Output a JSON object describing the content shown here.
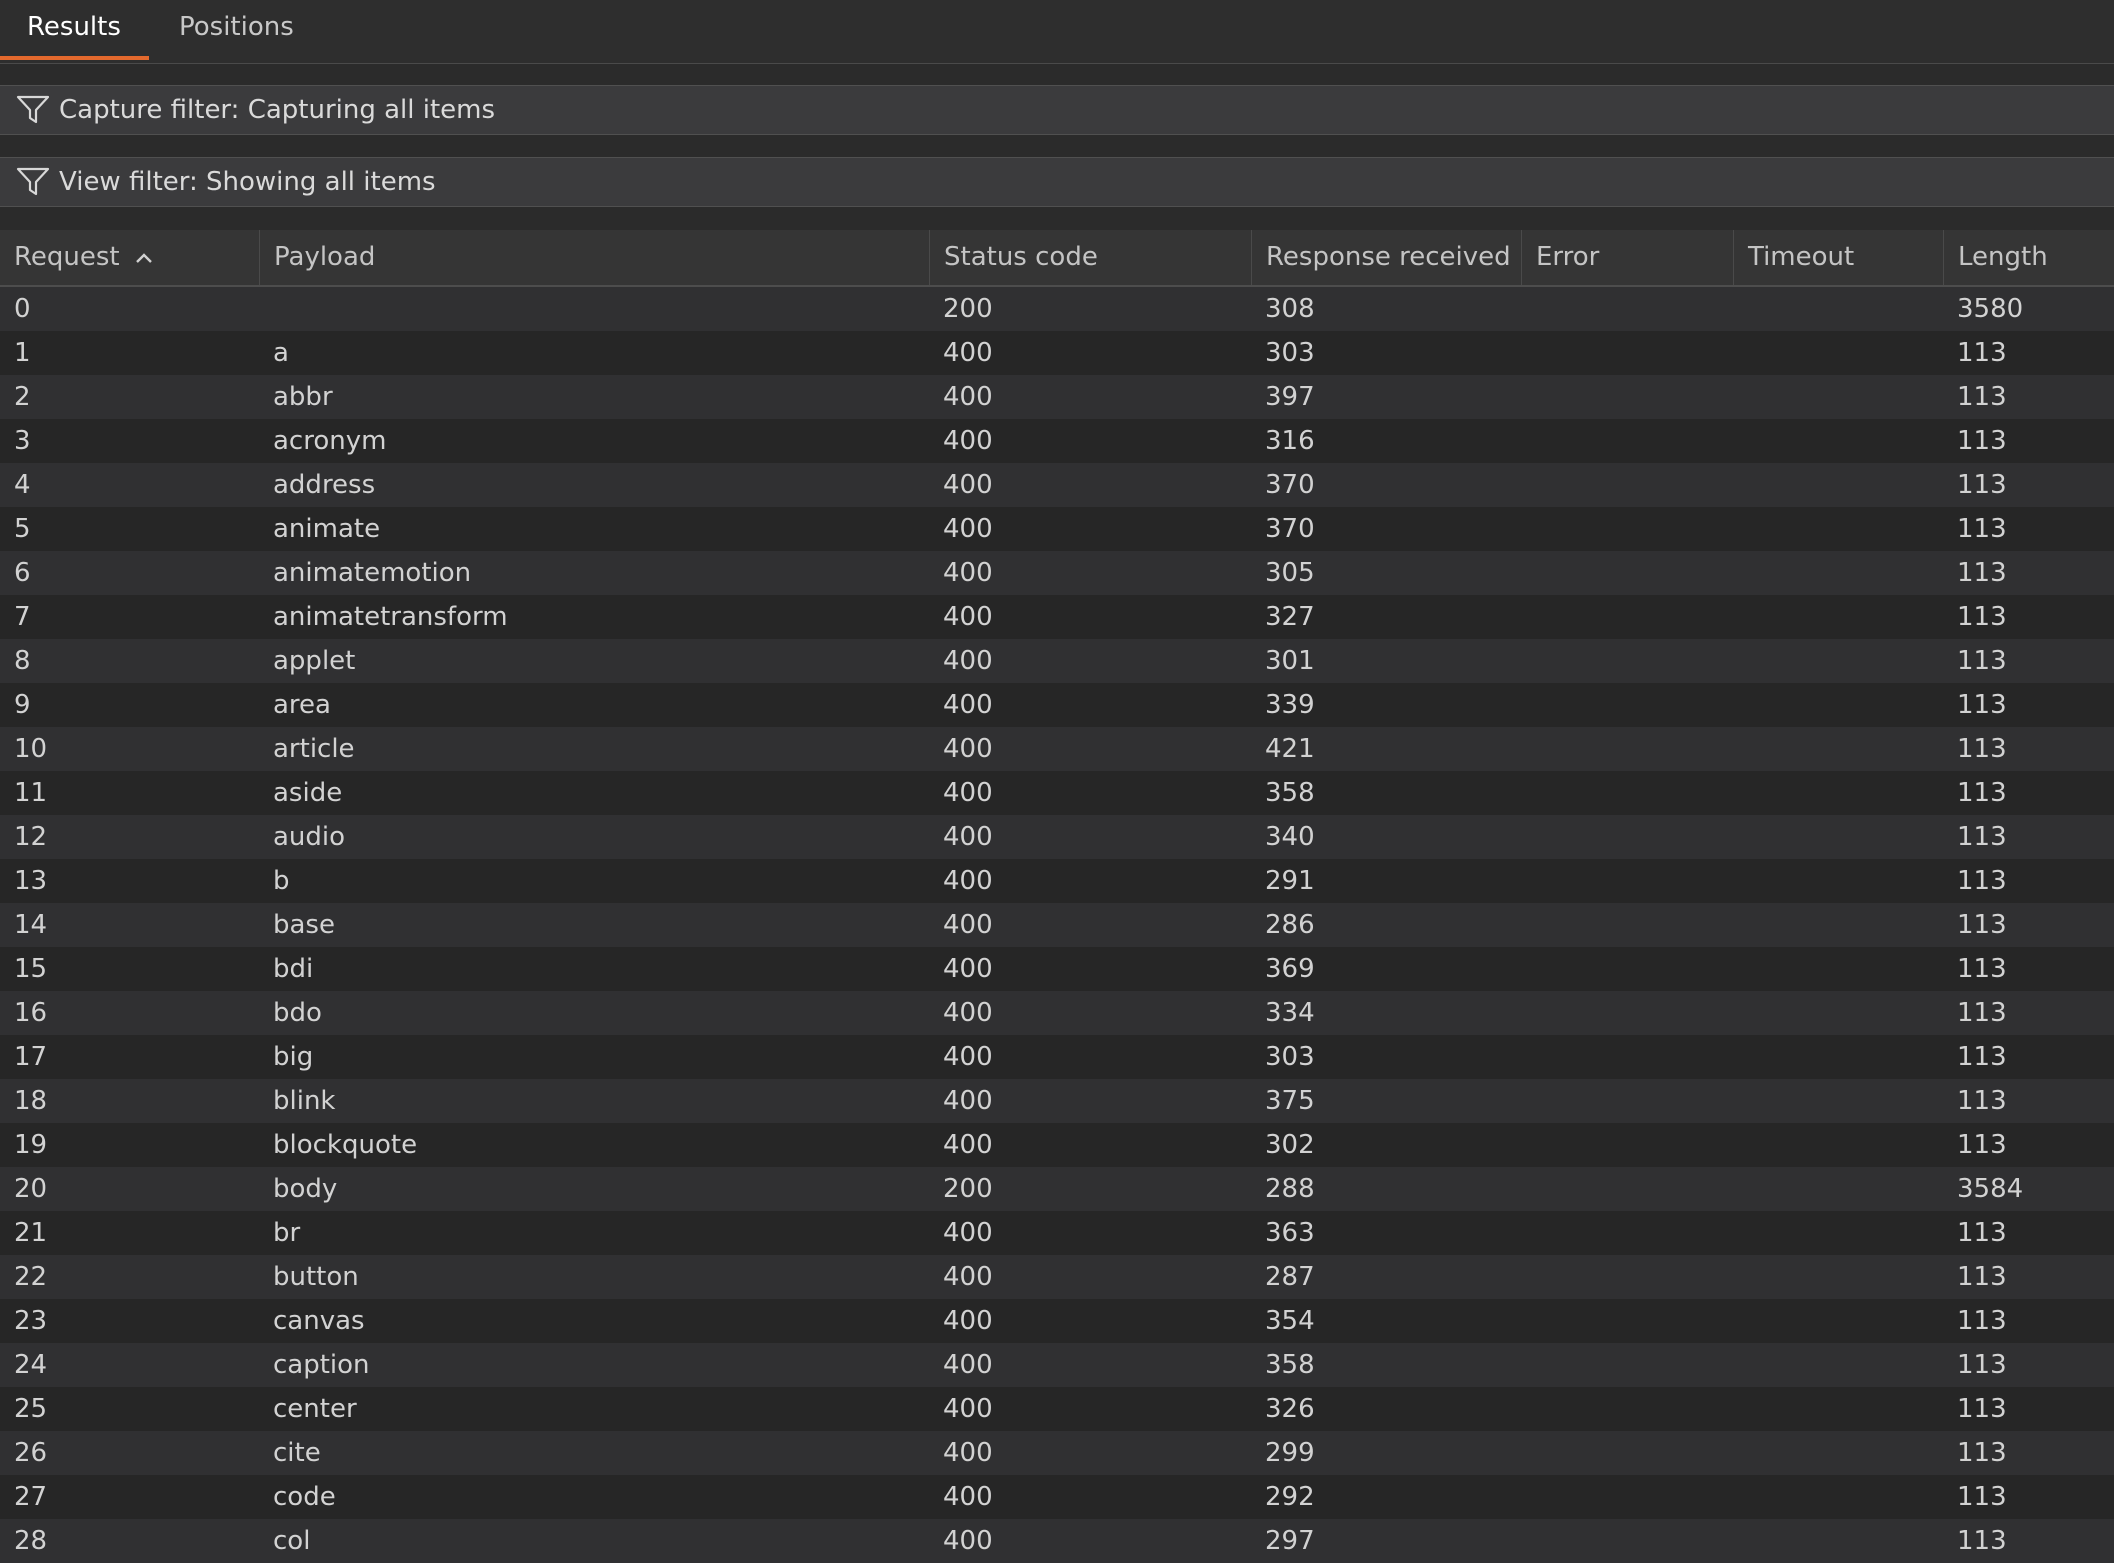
{
  "tabs": [
    {
      "label": "Results",
      "active": true
    },
    {
      "label": "Positions",
      "active": false
    }
  ],
  "filters": {
    "capture": "Capture filter: Capturing all items",
    "view": "View filter: Showing all items"
  },
  "icons": {
    "filter": "funnel-icon",
    "sort": "chevron-up-icon"
  },
  "colors": {
    "accent": "#e3692d",
    "background": "#2b2b2b"
  },
  "table": {
    "columns": [
      "Request",
      "Payload",
      "Status code",
      "Response received",
      "Error",
      "Timeout",
      "Length"
    ],
    "sort": {
      "column": "Request",
      "direction": "ascending"
    },
    "rows": [
      [
        "0",
        "",
        "200",
        "308",
        "",
        "",
        "3580"
      ],
      [
        "1",
        "a",
        "400",
        "303",
        "",
        "",
        "113"
      ],
      [
        "2",
        "abbr",
        "400",
        "397",
        "",
        "",
        "113"
      ],
      [
        "3",
        "acronym",
        "400",
        "316",
        "",
        "",
        "113"
      ],
      [
        "4",
        "address",
        "400",
        "370",
        "",
        "",
        "113"
      ],
      [
        "5",
        "animate",
        "400",
        "370",
        "",
        "",
        "113"
      ],
      [
        "6",
        "animatemotion",
        "400",
        "305",
        "",
        "",
        "113"
      ],
      [
        "7",
        "animatetransform",
        "400",
        "327",
        "",
        "",
        "113"
      ],
      [
        "8",
        "applet",
        "400",
        "301",
        "",
        "",
        "113"
      ],
      [
        "9",
        "area",
        "400",
        "339",
        "",
        "",
        "113"
      ],
      [
        "10",
        "article",
        "400",
        "421",
        "",
        "",
        "113"
      ],
      [
        "11",
        "aside",
        "400",
        "358",
        "",
        "",
        "113"
      ],
      [
        "12",
        "audio",
        "400",
        "340",
        "",
        "",
        "113"
      ],
      [
        "13",
        "b",
        "400",
        "291",
        "",
        "",
        "113"
      ],
      [
        "14",
        "base",
        "400",
        "286",
        "",
        "",
        "113"
      ],
      [
        "15",
        "bdi",
        "400",
        "369",
        "",
        "",
        "113"
      ],
      [
        "16",
        "bdo",
        "400",
        "334",
        "",
        "",
        "113"
      ],
      [
        "17",
        "big",
        "400",
        "303",
        "",
        "",
        "113"
      ],
      [
        "18",
        "blink",
        "400",
        "375",
        "",
        "",
        "113"
      ],
      [
        "19",
        "blockquote",
        "400",
        "302",
        "",
        "",
        "113"
      ],
      [
        "20",
        "body",
        "200",
        "288",
        "",
        "",
        "3584"
      ],
      [
        "21",
        "br",
        "400",
        "363",
        "",
        "",
        "113"
      ],
      [
        "22",
        "button",
        "400",
        "287",
        "",
        "",
        "113"
      ],
      [
        "23",
        "canvas",
        "400",
        "354",
        "",
        "",
        "113"
      ],
      [
        "24",
        "caption",
        "400",
        "358",
        "",
        "",
        "113"
      ],
      [
        "25",
        "center",
        "400",
        "326",
        "",
        "",
        "113"
      ],
      [
        "26",
        "cite",
        "400",
        "299",
        "",
        "",
        "113"
      ],
      [
        "27",
        "code",
        "400",
        "292",
        "",
        "",
        "113"
      ],
      [
        "28",
        "col",
        "400",
        "297",
        "",
        "",
        "113"
      ]
    ]
  }
}
